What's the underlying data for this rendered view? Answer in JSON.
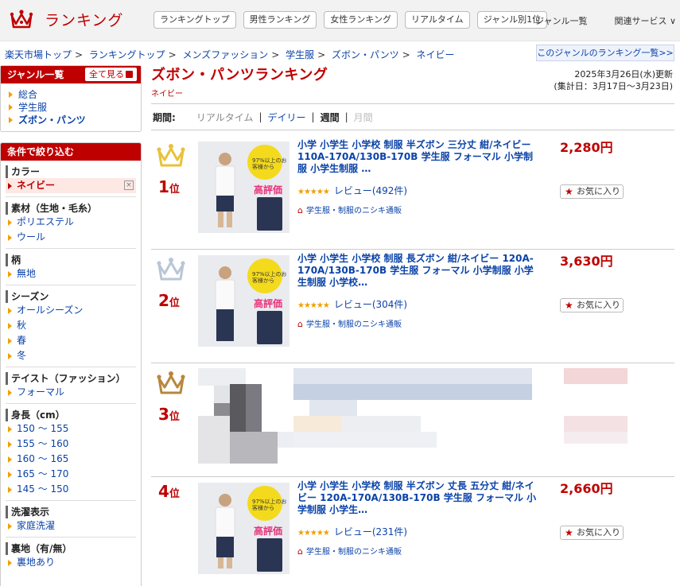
{
  "header": {
    "logo_text": "ランキング",
    "nav_buttons": [
      "ランキングトップ",
      "男性ランキング",
      "女性ランキング",
      "リアルタイム",
      "ジャンル別1位"
    ],
    "nav_links": [
      "ジャンル一覧",
      "関連サービス ∨"
    ]
  },
  "breadcrumb": [
    "楽天市場トップ",
    "ランキングトップ",
    "メンズファッション",
    "学生服",
    "ズボン・パンツ",
    "ネイビー"
  ],
  "genre_list_link": "このジャンルのランキング一覧>>",
  "sidebar": {
    "genre_title": "ジャンル一覧",
    "see_all": "全て見る",
    "genre_items": [
      "総合",
      "学生服",
      "ズボン・パンツ"
    ],
    "filter_title": "条件で絞り込む",
    "sections": [
      {
        "title": "カラー",
        "items": [
          "ネイビー"
        ]
      },
      {
        "title": "素材（生地・毛糸）",
        "items": [
          "ポリエステル",
          "ウール"
        ]
      },
      {
        "title": "柄",
        "items": [
          "無地"
        ]
      },
      {
        "title": "シーズン",
        "items": [
          "オールシーズン",
          "秋",
          "春",
          "冬"
        ]
      },
      {
        "title": "テイスト（ファッション）",
        "items": [
          "フォーマル"
        ]
      },
      {
        "title": "身長（cm）",
        "items": [
          "150 ～ 155",
          "155 ～ 160",
          "160 ～ 165",
          "165 ～ 170",
          "145 ～ 150"
        ]
      },
      {
        "title": "洗濯表示",
        "items": [
          "家庭洗濯"
        ]
      },
      {
        "title": "裏地（有/無）",
        "items": [
          "裏地あり"
        ]
      }
    ]
  },
  "main": {
    "title": "ズボン・パンツランキング",
    "subtitle": "ネイビー",
    "updated": "2025年3月26日(水)更新",
    "period_range": "(集計日：3月17日～3月23日)",
    "period_label": "期間:",
    "period_options": [
      "リアルタイム",
      "デイリー",
      "週間",
      "月間"
    ]
  },
  "items": [
    {
      "rank": "1",
      "rank_suffix": "位",
      "crown_color": "#e8c23a",
      "name": "小学 小学生 小学校 制服 半ズボン 三分丈 紺/ネイビー 110A-170A/130B-170B 学生服 フォーマル 小学制服 小学生制服 …",
      "stars": "★★★★★",
      "review": "レビュー(492件)",
      "shop": "学生服・制服のニシキ通販",
      "price": "2,280円",
      "fav": "お気に入り",
      "thumb_badge": "97%以上のお客様から",
      "thumb_hyoka": "高評価"
    },
    {
      "rank": "2",
      "rank_suffix": "位",
      "crown_color": "#b9c6d6",
      "name": "小学 小学生 小学校 制服 長ズボン 紺/ネイビー 120A-170A/130B-170B 学生服 フォーマル 小学制服 小学生制服 小学校…",
      "stars": "★★★★★",
      "review": "レビュー(304件)",
      "shop": "学生服・制服のニシキ通販",
      "price": "3,630円",
      "fav": "お気に入り",
      "thumb_badge": "97%以上のお客様から",
      "thumb_hyoka": "高評価"
    },
    {
      "rank": "3",
      "rank_suffix": "位",
      "crown_color": "#b8873d"
    },
    {
      "rank": "4",
      "rank_suffix": "位",
      "name": "小学 小学生 小学校 制服 半ズボン 丈長 五分丈 紺/ネイビー 120A-170A/130B-170B 学生服 フォーマル 小学制服 小学生…",
      "stars": "★★★★★",
      "review": "レビュー(231件)",
      "shop": "学生服・制服のニシキ通販",
      "price": "2,660円",
      "fav": "お気に入り",
      "thumb_badge": "97%以上のお客様から",
      "thumb_hyoka": "高評価"
    }
  ]
}
